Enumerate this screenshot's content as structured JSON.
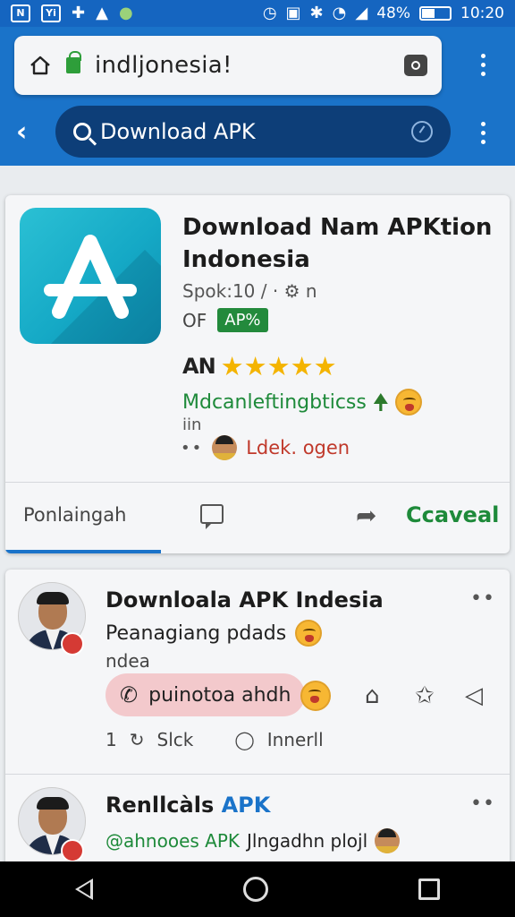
{
  "status_bar": {
    "left_icons": [
      "notification-box-icon",
      "notification-app-icon",
      "puzzle-icon",
      "cloud-icon",
      "leaf-app-icon"
    ],
    "right_icons": [
      "alarm-icon",
      "lock-icon",
      "bluetooth-icon",
      "wifi-icon",
      "signal-icon",
      "battery-icon"
    ],
    "battery": "48%",
    "battery_level": 0.48,
    "time": "10:20",
    "color": "#1565c0"
  },
  "browser": {
    "url": "indljonesia!",
    "search_query": "Download APK"
  },
  "app": {
    "title": "Download Nam APKtion Indonesia",
    "meta": "Spok:10 / · ⚙ n",
    "of_label": "OF",
    "badge": "AP%",
    "rating_label": "AN",
    "stars": 5,
    "tagline": "Mdcanleftingbticss",
    "small": "iin",
    "dots": "••",
    "developer": "Ldek. ogen",
    "tabs": {
      "primary": "Ponlaingah",
      "cancel": "Ccaveal"
    }
  },
  "posts": [
    {
      "title": "Downloala APK Indesia",
      "subtitle": "Peanagiang pdads",
      "sub2": "ndea",
      "bubble": "puinotoa ahdh",
      "likes": "1",
      "slick": "Slck",
      "innerll": "Innerll",
      "more": "••"
    },
    {
      "title_a": "Renllcàls",
      "title_b": "APK",
      "handle": "@ahnooes APK",
      "text": "Jlngadhn plojl",
      "more": "••"
    }
  ],
  "colors": {
    "chrome": "#1a73c9",
    "search_bg": "#0d3e78",
    "accent_green": "#1e8a3a",
    "star": "#f4b400",
    "dev_red": "#c0392b"
  }
}
